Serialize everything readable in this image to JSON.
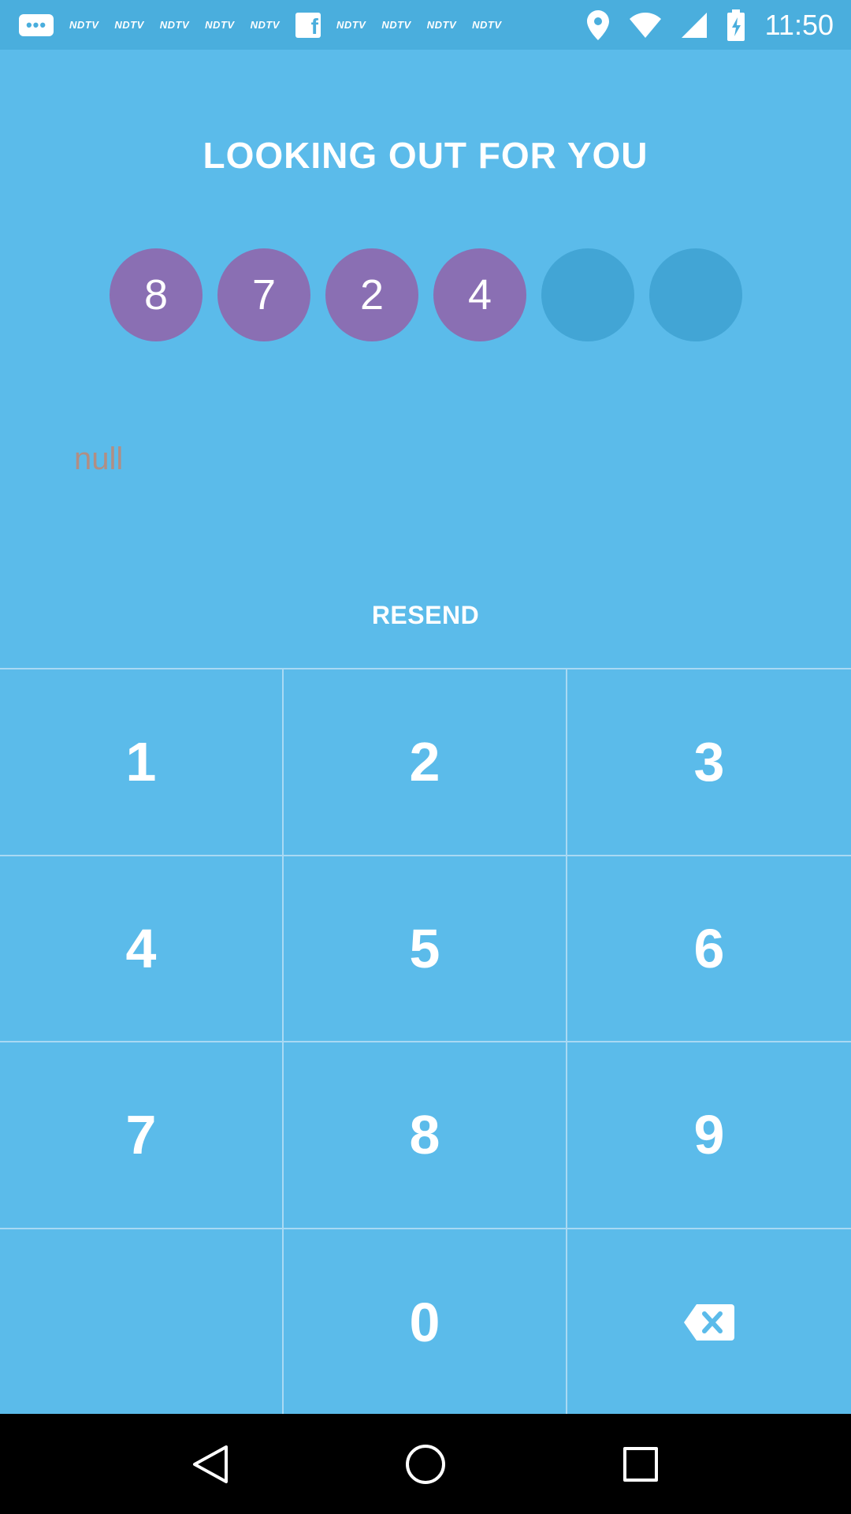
{
  "status_bar": {
    "notification_icons": [
      "message-icon",
      "ndtv-icon",
      "ndtv-icon",
      "ndtv-icon",
      "ndtv-icon",
      "ndtv-icon",
      "facebook-icon",
      "ndtv-icon",
      "ndtv-icon",
      "ndtv-icon",
      "ndtv-icon"
    ],
    "ndtv_text": "NDTV",
    "time": "11:50"
  },
  "title": "LOOKING OUT FOR YOU",
  "pin": {
    "digits": [
      "8",
      "7",
      "2",
      "4",
      "",
      ""
    ]
  },
  "message": "null",
  "resend_label": "RESEND",
  "keypad": {
    "keys": [
      "1",
      "2",
      "3",
      "4",
      "5",
      "6",
      "7",
      "8",
      "9",
      "",
      "0",
      "backspace"
    ]
  },
  "colors": {
    "background": "#5bbbea",
    "pin_filled": "#8a6fb3",
    "pin_empty": "#42a5d5",
    "message_text": "#b18e84"
  }
}
